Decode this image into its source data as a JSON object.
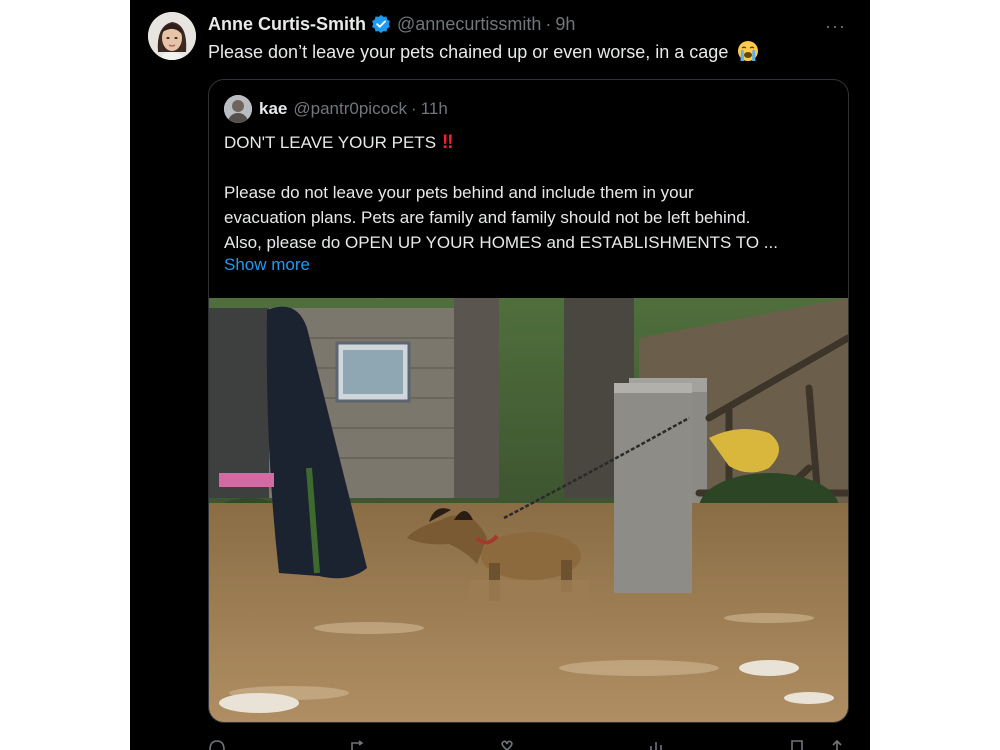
{
  "tweet": {
    "author_name": "Anne Curtis-Smith",
    "handle": "@annecurtissmith",
    "separator": "·",
    "time": "9h",
    "text": "Please don’t leave your pets chained up or even worse, in a cage",
    "more_icon": "···"
  },
  "quoted": {
    "author_name": "kae",
    "handle": "@pantr0picock",
    "separator": "·",
    "time": "11h",
    "title": "DON'T LEAVE YOUR PETS",
    "title_emoji": "‼",
    "body_lines": [
      "Please do not leave your pets behind and include them in your",
      "evacuation plans. Pets are family and family should not be left behind.",
      "Also, please do OPEN UP YOUR HOMES and ESTABLISHMENTS TO ..."
    ],
    "show_more": "Show more",
    "image_alt": "A dog chained in flood water beside a concrete house"
  },
  "colors": {
    "background": "#000000",
    "text": "#e7e9ea",
    "muted": "#71767b",
    "link": "#1d9bf0",
    "border": "#2f3336",
    "verified": "#1d9bf0"
  }
}
